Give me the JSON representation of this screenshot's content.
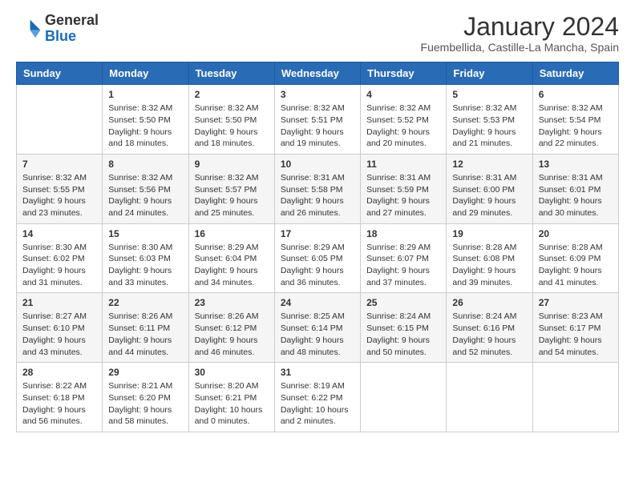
{
  "header": {
    "logo": {
      "general": "General",
      "blue": "Blue"
    },
    "title": "January 2024",
    "subtitle": "Fuembellida, Castille-La Mancha, Spain"
  },
  "days_of_week": [
    "Sunday",
    "Monday",
    "Tuesday",
    "Wednesday",
    "Thursday",
    "Friday",
    "Saturday"
  ],
  "weeks": [
    [
      {
        "day": "",
        "info": ""
      },
      {
        "day": "1",
        "info": "Sunrise: 8:32 AM\nSunset: 5:50 PM\nDaylight: 9 hours\nand 18 minutes."
      },
      {
        "day": "2",
        "info": "Sunrise: 8:32 AM\nSunset: 5:50 PM\nDaylight: 9 hours\nand 18 minutes."
      },
      {
        "day": "3",
        "info": "Sunrise: 8:32 AM\nSunset: 5:51 PM\nDaylight: 9 hours\nand 19 minutes."
      },
      {
        "day": "4",
        "info": "Sunrise: 8:32 AM\nSunset: 5:52 PM\nDaylight: 9 hours\nand 20 minutes."
      },
      {
        "day": "5",
        "info": "Sunrise: 8:32 AM\nSunset: 5:53 PM\nDaylight: 9 hours\nand 21 minutes."
      },
      {
        "day": "6",
        "info": "Sunrise: 8:32 AM\nSunset: 5:54 PM\nDaylight: 9 hours\nand 22 minutes."
      }
    ],
    [
      {
        "day": "7",
        "info": "Sunrise: 8:32 AM\nSunset: 5:55 PM\nDaylight: 9 hours\nand 23 minutes."
      },
      {
        "day": "8",
        "info": "Sunrise: 8:32 AM\nSunset: 5:56 PM\nDaylight: 9 hours\nand 24 minutes."
      },
      {
        "day": "9",
        "info": "Sunrise: 8:32 AM\nSunset: 5:57 PM\nDaylight: 9 hours\nand 25 minutes."
      },
      {
        "day": "10",
        "info": "Sunrise: 8:31 AM\nSunset: 5:58 PM\nDaylight: 9 hours\nand 26 minutes."
      },
      {
        "day": "11",
        "info": "Sunrise: 8:31 AM\nSunset: 5:59 PM\nDaylight: 9 hours\nand 27 minutes."
      },
      {
        "day": "12",
        "info": "Sunrise: 8:31 AM\nSunset: 6:00 PM\nDaylight: 9 hours\nand 29 minutes."
      },
      {
        "day": "13",
        "info": "Sunrise: 8:31 AM\nSunset: 6:01 PM\nDaylight: 9 hours\nand 30 minutes."
      }
    ],
    [
      {
        "day": "14",
        "info": "Sunrise: 8:30 AM\nSunset: 6:02 PM\nDaylight: 9 hours\nand 31 minutes."
      },
      {
        "day": "15",
        "info": "Sunrise: 8:30 AM\nSunset: 6:03 PM\nDaylight: 9 hours\nand 33 minutes."
      },
      {
        "day": "16",
        "info": "Sunrise: 8:29 AM\nSunset: 6:04 PM\nDaylight: 9 hours\nand 34 minutes."
      },
      {
        "day": "17",
        "info": "Sunrise: 8:29 AM\nSunset: 6:05 PM\nDaylight: 9 hours\nand 36 minutes."
      },
      {
        "day": "18",
        "info": "Sunrise: 8:29 AM\nSunset: 6:07 PM\nDaylight: 9 hours\nand 37 minutes."
      },
      {
        "day": "19",
        "info": "Sunrise: 8:28 AM\nSunset: 6:08 PM\nDaylight: 9 hours\nand 39 minutes."
      },
      {
        "day": "20",
        "info": "Sunrise: 8:28 AM\nSunset: 6:09 PM\nDaylight: 9 hours\nand 41 minutes."
      }
    ],
    [
      {
        "day": "21",
        "info": "Sunrise: 8:27 AM\nSunset: 6:10 PM\nDaylight: 9 hours\nand 43 minutes."
      },
      {
        "day": "22",
        "info": "Sunrise: 8:26 AM\nSunset: 6:11 PM\nDaylight: 9 hours\nand 44 minutes."
      },
      {
        "day": "23",
        "info": "Sunrise: 8:26 AM\nSunset: 6:12 PM\nDaylight: 9 hours\nand 46 minutes."
      },
      {
        "day": "24",
        "info": "Sunrise: 8:25 AM\nSunset: 6:14 PM\nDaylight: 9 hours\nand 48 minutes."
      },
      {
        "day": "25",
        "info": "Sunrise: 8:24 AM\nSunset: 6:15 PM\nDaylight: 9 hours\nand 50 minutes."
      },
      {
        "day": "26",
        "info": "Sunrise: 8:24 AM\nSunset: 6:16 PM\nDaylight: 9 hours\nand 52 minutes."
      },
      {
        "day": "27",
        "info": "Sunrise: 8:23 AM\nSunset: 6:17 PM\nDaylight: 9 hours\nand 54 minutes."
      }
    ],
    [
      {
        "day": "28",
        "info": "Sunrise: 8:22 AM\nSunset: 6:18 PM\nDaylight: 9 hours\nand 56 minutes."
      },
      {
        "day": "29",
        "info": "Sunrise: 8:21 AM\nSunset: 6:20 PM\nDaylight: 9 hours\nand 58 minutes."
      },
      {
        "day": "30",
        "info": "Sunrise: 8:20 AM\nSunset: 6:21 PM\nDaylight: 10 hours\nand 0 minutes."
      },
      {
        "day": "31",
        "info": "Sunrise: 8:19 AM\nSunset: 6:22 PM\nDaylight: 10 hours\nand 2 minutes."
      },
      {
        "day": "",
        "info": ""
      },
      {
        "day": "",
        "info": ""
      },
      {
        "day": "",
        "info": ""
      }
    ]
  ]
}
